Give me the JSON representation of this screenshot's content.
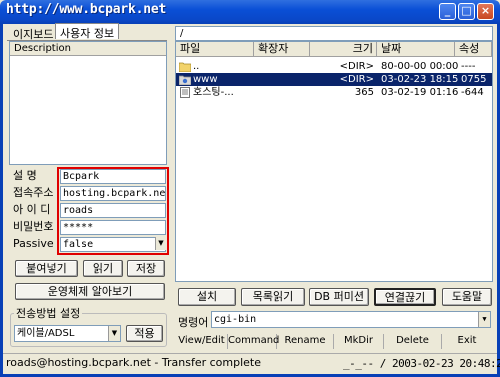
{
  "window": {
    "title": "http://www.bcpark.net"
  },
  "left_tabs": [
    "이지보드",
    "사용자 정보"
  ],
  "description": {
    "header": "Description"
  },
  "form": {
    "fields": [
      {
        "label": "설    명",
        "value": "Bcpark"
      },
      {
        "label": "접속주소",
        "value": "hosting.bcpark.net"
      },
      {
        "label": "아 이 디",
        "value": "roads"
      },
      {
        "label": "비밀번호",
        "value": "*****"
      },
      {
        "label": "Passive",
        "value": "false"
      }
    ]
  },
  "buttons": {
    "paste": "붙여넣기",
    "read": "읽기",
    "save": "저장",
    "os_detect": "운영체제 알아보기",
    "apply": "적용"
  },
  "transfer": {
    "title": "전송방법 설정",
    "selected": "케이블/ADSL"
  },
  "path": "/",
  "file_columns": [
    "파일",
    "확장자",
    "크기",
    "날짜",
    "속성"
  ],
  "files": [
    {
      "name": "..",
      "icon": "folder-icon",
      "size": "<DIR>",
      "date": "80-00-00 00:00",
      "attr": "----",
      "selected": false
    },
    {
      "name": "www",
      "icon": "folder-link-icon",
      "size": "<DIR>",
      "date": "03-02-23 18:15",
      "attr": "0755",
      "selected": true
    },
    {
      "name": "호스팅-...",
      "icon": "file-icon",
      "size": "365",
      "date": "03-02-19 01:16",
      "attr": "-644",
      "selected": false
    }
  ],
  "right_buttons": [
    "설치",
    "목록읽기",
    "DB 퍼미션",
    "연결끊기",
    "도움말"
  ],
  "command": {
    "label": "명령어",
    "value": "cgi-bin"
  },
  "toolbar": [
    "View/Edit",
    "Command",
    "Rename",
    "MkDir",
    "Delete",
    "Exit"
  ],
  "status": {
    "left": "roads@hosting.bcpark.net - Transfer complete",
    "right": "_-_-- / 2003-02-23 20:48:28"
  },
  "colors": {
    "title_bar": "#0a48c9",
    "selection": "#0a246a",
    "highlight_box": "#e00000"
  }
}
